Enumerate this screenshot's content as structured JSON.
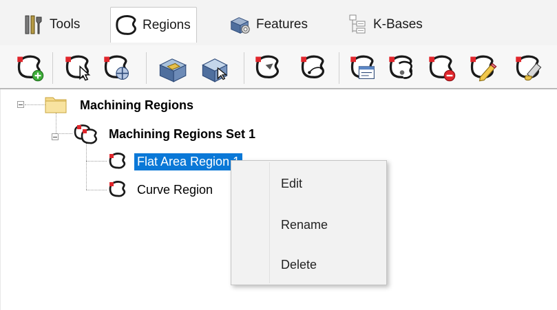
{
  "tabs": [
    {
      "label": "Tools",
      "icon": "tools-icon"
    },
    {
      "label": "Regions",
      "icon": "regions-icon",
      "active": true
    },
    {
      "label": "Features",
      "icon": "features-icon"
    },
    {
      "label": "K-Bases",
      "icon": "kbases-icon"
    }
  ],
  "toolbar_buttons": [
    "new-region-set-icon",
    "select-region-icon",
    "region-boundary-icon",
    "region-from-feature-icon",
    "region-from-face-icon",
    "region-point-icon",
    "region-orientation-icon",
    "region-properties-icon",
    "merge-regions-icon",
    "delete-region-icon",
    "edit-region-icon",
    "paint-region-icon"
  ],
  "tree": {
    "root": "Machining Regions",
    "set": "Machining Regions Set 1",
    "items": [
      "Flat Area Region 1",
      "Curve Region"
    ]
  },
  "context_menu": {
    "items": [
      "Edit",
      "Rename",
      "Delete"
    ]
  },
  "colors": {
    "selection": "#0a78d7",
    "region_outline": "#1a1a1a",
    "region_marker": "#e0262c"
  }
}
